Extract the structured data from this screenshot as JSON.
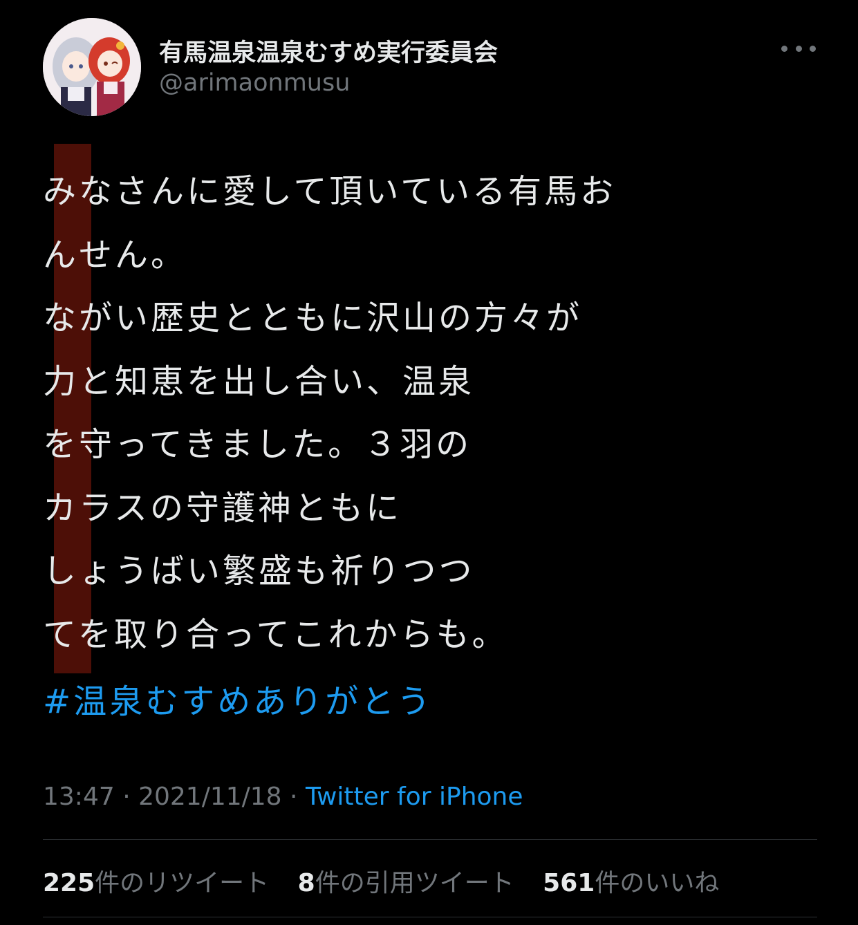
{
  "account": {
    "display_name": "有馬温泉温泉むすめ実行委員会",
    "handle": "@arimaonmusu",
    "avatar_icon": "avatar-image"
  },
  "tweet": {
    "lines": [
      "みなさんに愛して頂いている有馬お",
      "んせん。",
      "ながい歴史とともに沢山の方々が",
      "力と知恵を出し合い、温泉",
      "を守ってきました。３羽の",
      "カラスの守護神ともに",
      "しょうばい繁盛も祈りつつ",
      "てを取り合ってこれからも。"
    ],
    "hashtag": "#温泉むすめありがとう",
    "time": "13:47",
    "separator": "·",
    "date": "2021/11/18",
    "source": "Twitter for iPhone"
  },
  "stats": {
    "retweets": {
      "count": "225",
      "label": "件のリツイート"
    },
    "quotes": {
      "count": "8",
      "label": "件の引用ツイート"
    },
    "likes": {
      "count": "561",
      "label": "件のいいね"
    }
  },
  "colors": {
    "background": "#000000",
    "text": "#e7e9ea",
    "secondary": "#71767b",
    "link": "#1d9bf0",
    "highlight": "#5a1208"
  },
  "icons": {
    "more": "more-dots-icon"
  }
}
